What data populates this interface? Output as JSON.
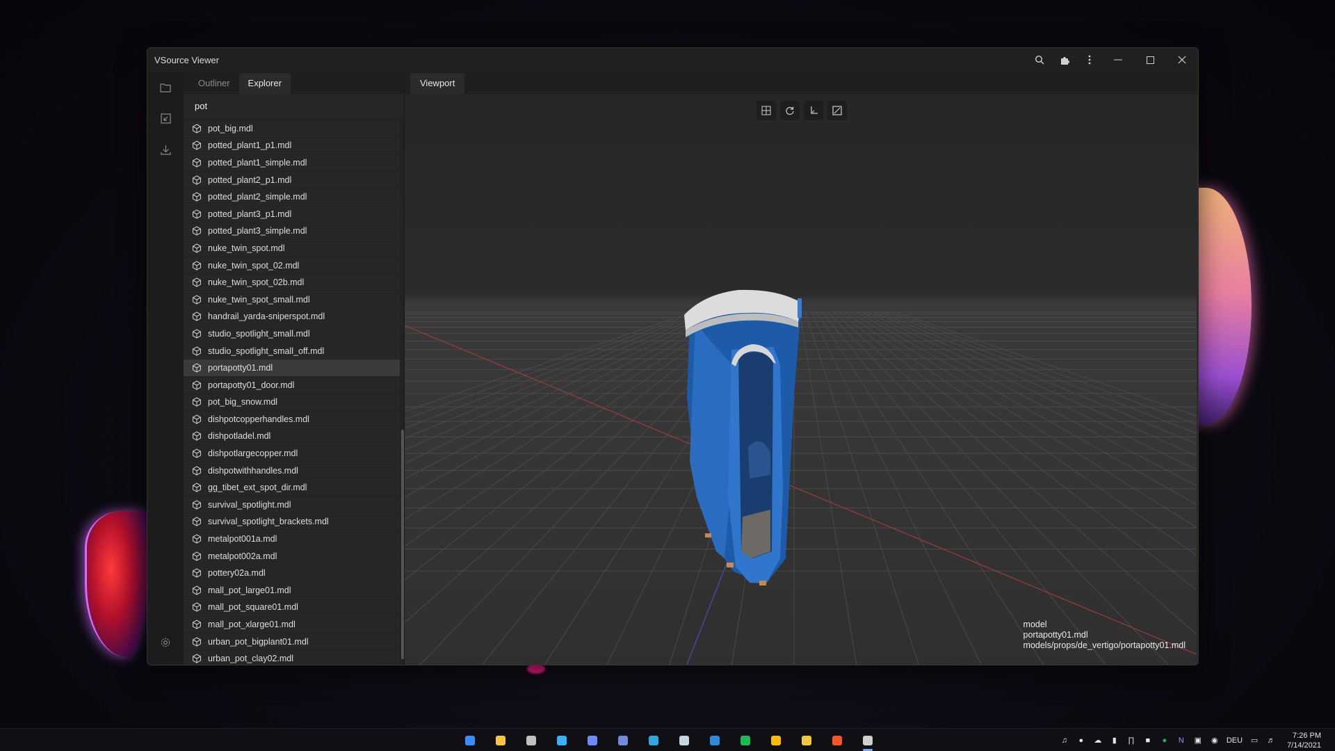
{
  "window": {
    "title": "VSource Viewer"
  },
  "sidebar": {
    "tabs": [
      "Outliner",
      "Explorer"
    ],
    "active_tab": "Explorer",
    "search_value": "pot",
    "selected_index": 14,
    "items": [
      "pot_big.mdl",
      "potted_plant1_p1.mdl",
      "potted_plant1_simple.mdl",
      "potted_plant2_p1.mdl",
      "potted_plant2_simple.mdl",
      "potted_plant3_p1.mdl",
      "potted_plant3_simple.mdl",
      "nuke_twin_spot.mdl",
      "nuke_twin_spot_02.mdl",
      "nuke_twin_spot_02b.mdl",
      "nuke_twin_spot_small.mdl",
      "handrail_yarda-sniperspot.mdl",
      "studio_spotlight_small.mdl",
      "studio_spotlight_small_off.mdl",
      "portapotty01.mdl",
      "portapotty01_door.mdl",
      "pot_big_snow.mdl",
      "dishpotcopperhandles.mdl",
      "dishpotladel.mdl",
      "dishpotlargecopper.mdl",
      "dishpotwithhandles.mdl",
      "gg_tibet_ext_spot_dir.mdl",
      "survival_spotlight.mdl",
      "survival_spotlight_brackets.mdl",
      "metalpot001a.mdl",
      "metalpot002a.mdl",
      "pottery02a.mdl",
      "mall_pot_large01.mdl",
      "mall_pot_square01.mdl",
      "mall_pot_xlarge01.mdl",
      "urban_pot_bigplant01.mdl",
      "urban_pot_clay02.mdl"
    ]
  },
  "viewport": {
    "tab_label": "Viewport",
    "info": {
      "line1": "model",
      "line2": "portapotty01.mdl",
      "line3": "models/props/de_vertigo/portapotty01.mdl"
    }
  },
  "taskbar": {
    "language": "DEU",
    "time": "7:26 PM",
    "date": "7/14/2021",
    "apps": [
      "windows-start",
      "file-explorer",
      "terminal",
      "photoshop",
      "app-icon",
      "discord",
      "edge",
      "steam",
      "vscode",
      "spotify",
      "chrome",
      "app-yellow",
      "brave",
      "dev-tool"
    ]
  },
  "colors": {
    "accent": "#3a7bd5",
    "background": "#1f1f1f",
    "selection": "#3a3a3a"
  }
}
